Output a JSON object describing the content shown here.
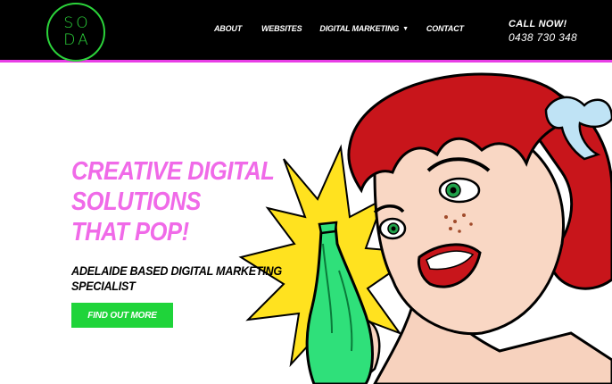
{
  "logo": {
    "line1": "SO",
    "line2": "DA"
  },
  "nav": {
    "items": [
      {
        "label": "ABOUT"
      },
      {
        "label": "WEBSITES"
      },
      {
        "label": "DIGITAL MARKETING",
        "has_dropdown": true
      },
      {
        "label": "CONTACT"
      }
    ]
  },
  "contact": {
    "label": "CALL NOW!",
    "phone": "0438 730 348"
  },
  "hero": {
    "headline": [
      "CREATIVE DIGITAL",
      "SOLUTIONS",
      "THAT POP!"
    ],
    "subheadline": [
      "ADELAIDE BASED DIGITAL MARKETING",
      "SPECIALIST"
    ],
    "cta_label": "FIND OUT MORE"
  },
  "colors": {
    "header_bg": "#000000",
    "accent_pink": "#f06ae8",
    "accent_green": "#1fd43a",
    "logo_green": "#2bd33a",
    "header_border": "#e83ee6"
  },
  "icons": {
    "dropdown": "chevron-down-icon"
  }
}
